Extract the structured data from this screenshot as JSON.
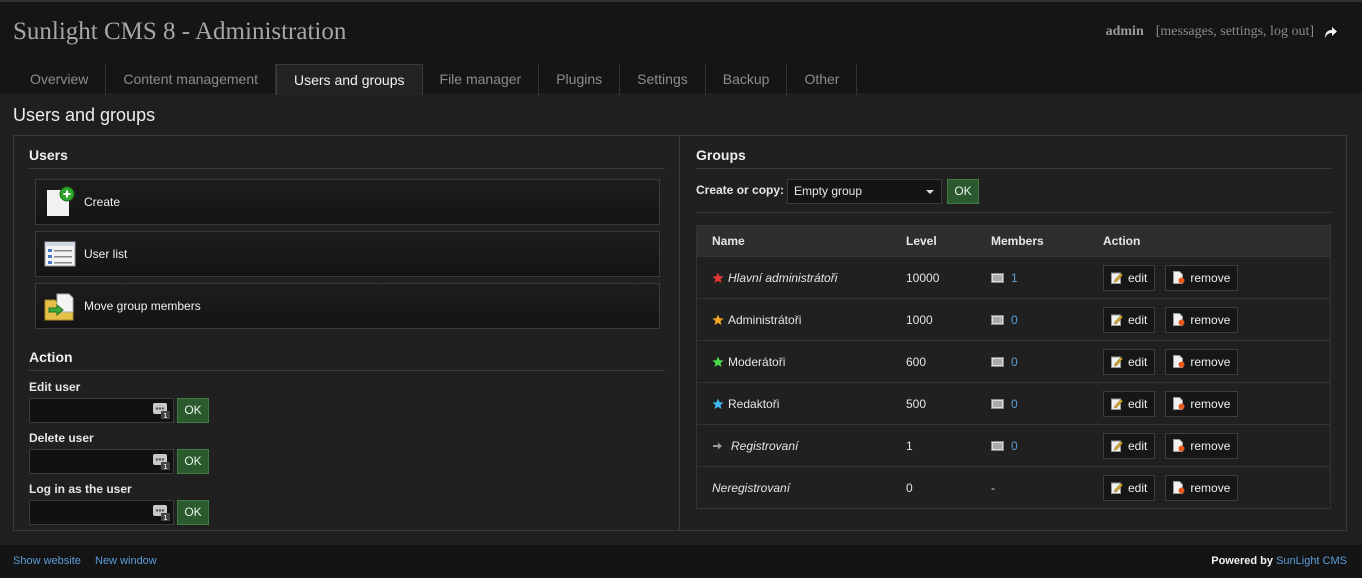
{
  "header": {
    "title": "Sunlight CMS 8 - Administration",
    "username": "admin",
    "user_links": "[messages, settings, log out]"
  },
  "tabs": [
    {
      "label": "Overview"
    },
    {
      "label": "Content management"
    },
    {
      "label": "Users and groups",
      "active": true
    },
    {
      "label": "File manager"
    },
    {
      "label": "Plugins"
    },
    {
      "label": "Settings"
    },
    {
      "label": "Backup"
    },
    {
      "label": "Other"
    }
  ],
  "page_title": "Users and groups",
  "users": {
    "heading": "Users",
    "buttons": [
      {
        "label": "Create",
        "icon": "user-create-icon"
      },
      {
        "label": "User list",
        "icon": "user-list-icon"
      },
      {
        "label": "Move group members",
        "icon": "move-members-icon"
      }
    ]
  },
  "action": {
    "heading": "Action",
    "fields": [
      {
        "label": "Edit user",
        "value": "",
        "ok": "OK"
      },
      {
        "label": "Delete user",
        "value": "",
        "ok": "OK"
      },
      {
        "label": "Log in as the user",
        "value": "",
        "ok": "OK"
      }
    ]
  },
  "groups": {
    "heading": "Groups",
    "copy_label": "Create or copy:",
    "copy_selected": "Empty group",
    "copy_ok": "OK",
    "columns": [
      "Name",
      "Level",
      "Members",
      "Action"
    ],
    "rows": [
      {
        "name": "Hlavní administrátoři",
        "level": "10000",
        "members": "1",
        "icon_color": "#e53935",
        "icon": "star-icon",
        "italic": true
      },
      {
        "name": "Administrátoři",
        "level": "1000",
        "members": "0",
        "icon_color": "#f5a623",
        "icon": "star-icon",
        "italic": false
      },
      {
        "name": "Moderátoři",
        "level": "600",
        "members": "0",
        "icon_color": "#4cdc4c",
        "icon": "star-icon",
        "italic": false
      },
      {
        "name": "Redaktoři",
        "level": "500",
        "members": "0",
        "icon_color": "#3fb8f0",
        "icon": "star-icon",
        "italic": false
      },
      {
        "name": "Registrovaní",
        "level": "1",
        "members": "0",
        "icon_color": "#9a9a9a",
        "icon": "arrow-icon",
        "italic": true
      },
      {
        "name": "Neregistrovaní",
        "level": "0",
        "members": "-",
        "icon_color": "",
        "icon": "",
        "italic": true
      }
    ],
    "edit_label": "edit",
    "remove_label": "remove"
  },
  "footer": {
    "show_website": "Show website",
    "new_window": "New window",
    "powered_by": "Powered by",
    "powered_name": "SunLight CMS"
  },
  "colors": {
    "link": "#5b9ddb",
    "ok_button": "#2a5a2e"
  }
}
